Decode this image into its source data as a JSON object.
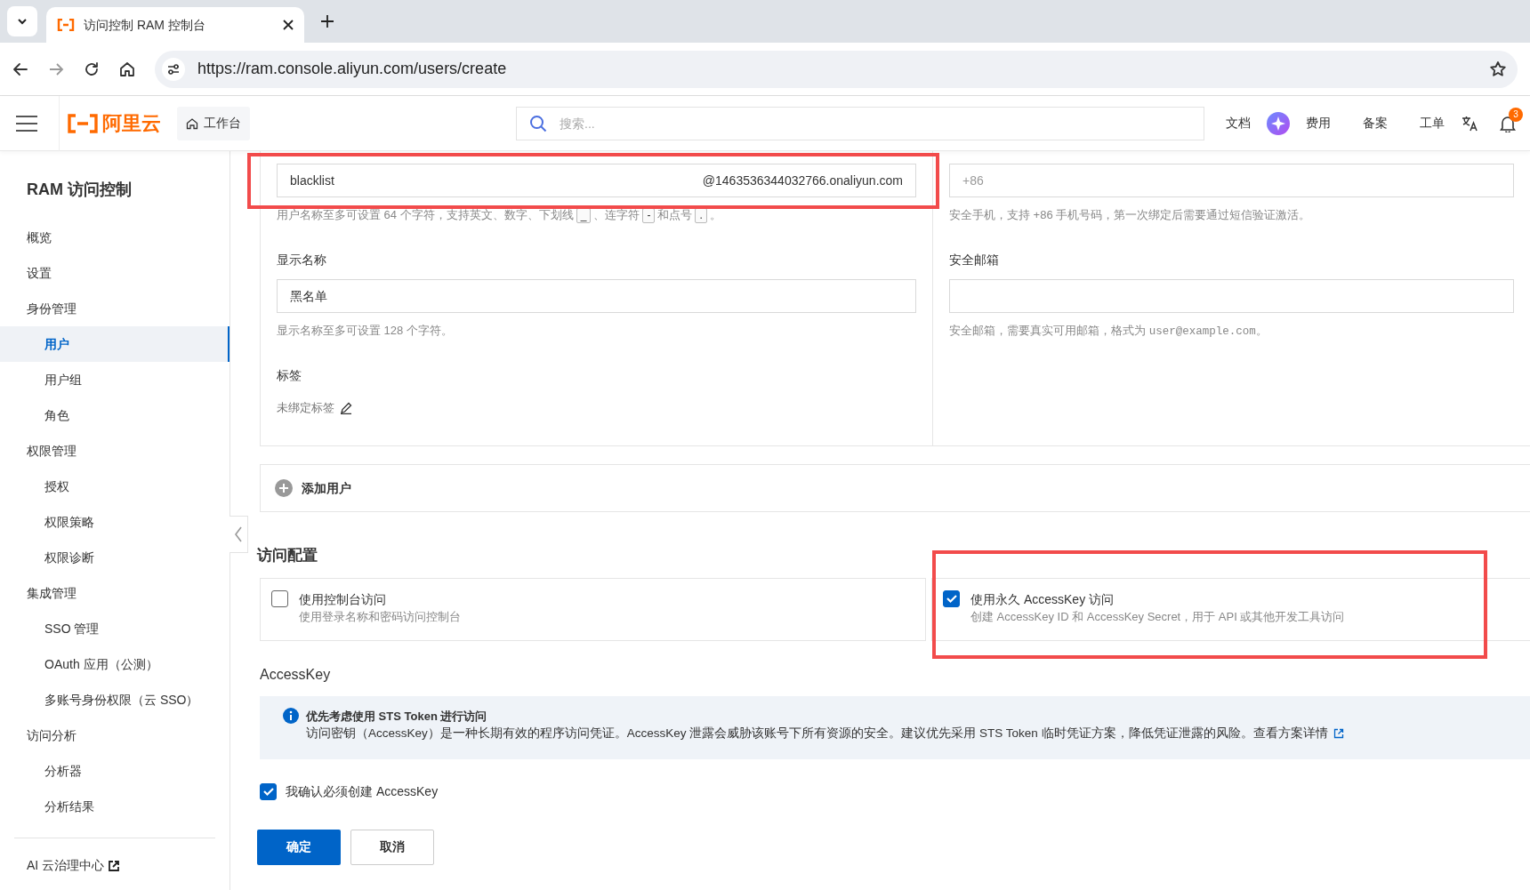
{
  "browser": {
    "tabs": [
      {
        "title": "访问控制 RAM 控制台",
        "selected": true
      }
    ],
    "url": "https://ram.console.aliyun.com/users/create"
  },
  "header": {
    "logo": "阿里云",
    "workbench": "工作台",
    "search_placeholder": "搜索...",
    "links": [
      "文档",
      "费用",
      "备案",
      "工单"
    ],
    "notification_count": "3"
  },
  "sidebar": {
    "title": "RAM 访问控制",
    "items": [
      {
        "label": "概览",
        "selected": false
      },
      {
        "label": "设置",
        "selected": false
      },
      {
        "label": "身份管理",
        "selected": false,
        "children": [
          {
            "label": "用户",
            "selected": true
          },
          {
            "label": "用户组",
            "selected": false
          },
          {
            "label": "角色",
            "selected": false
          }
        ]
      },
      {
        "label": "权限管理",
        "selected": false,
        "children": [
          {
            "label": "授权",
            "selected": false
          },
          {
            "label": "权限策略",
            "selected": false
          },
          {
            "label": "权限诊断",
            "selected": false
          }
        ]
      },
      {
        "label": "集成管理",
        "selected": false,
        "children": [
          {
            "label": "SSO 管理",
            "selected": false
          },
          {
            "label": "OAuth 应用（公测）",
            "selected": false
          },
          {
            "label": "多账号身份权限（云 SSO）",
            "selected": false
          }
        ]
      },
      {
        "label": "访问分析",
        "selected": false,
        "children": [
          {
            "label": "分析器",
            "selected": false
          },
          {
            "label": "分析结果",
            "selected": false
          }
        ]
      }
    ],
    "footer_link": "AI 云治理中心"
  },
  "user_form": {
    "username": {
      "value": "blacklist",
      "suffix": "@1463536344032766.onaliyun.com"
    },
    "username_hint": [
      {
        "kind": "text",
        "text": "用户名称至多可设置 64 个字符，支持英文、数字、下划线"
      },
      {
        "kind": "key",
        "text": "_"
      },
      {
        "kind": "text",
        "text": "、连字符"
      },
      {
        "kind": "key",
        "text": "-"
      },
      {
        "kind": "text",
        "text": "和点号"
      },
      {
        "kind": "key",
        "text": "."
      },
      {
        "kind": "text",
        "text": "。"
      }
    ],
    "phone": {
      "placeholder": "+86"
    },
    "phone_hint": "安全手机，支持 +86 手机号码，第一次绑定后需要通过短信验证激活。",
    "display_name": {
      "label": "显示名称",
      "value": "黑名单",
      "hint": "显示名称至多可设置 128 个字符。"
    },
    "email": {
      "label": "安全邮箱",
      "hint": [
        {
          "kind": "text",
          "text": "安全邮箱，需要真实可用邮箱，格式为 "
        },
        {
          "kind": "code",
          "text": "user@example.com"
        },
        {
          "kind": "text",
          "text": "。"
        }
      ]
    },
    "tags": {
      "label": "标签",
      "value": "未绑定标签"
    }
  },
  "add_user": "添加用户",
  "access_config": {
    "title": "访问配置",
    "options": [
      {
        "title": "使用控制台访问",
        "description": "使用登录名称和密码访问控制台",
        "checked": false
      },
      {
        "title": "使用永久 AccessKey 访问",
        "description": "创建 AccessKey ID 和 AccessKey Secret，用于 API 或其他开发工具访问",
        "checked": true
      }
    ]
  },
  "accesskey": {
    "title": "AccessKey",
    "alert": {
      "title": "优先考虑使用 STS Token 进行访问",
      "text": "访问密钥（AccessKey）是一种长期有效的程序访问凭证。AccessKey 泄露会威胁该账号下所有资源的安全。建议优先采用 STS Token 临时凭证方案，降低凭证泄露的风险。",
      "link": "查看方案详情"
    },
    "confirm": {
      "label": "我确认必须创建 AccessKey",
      "checked": true
    }
  },
  "buttons": [
    {
      "label": "确定",
      "kind": "primary"
    },
    {
      "label": "取消",
      "kind": "secondary"
    }
  ]
}
